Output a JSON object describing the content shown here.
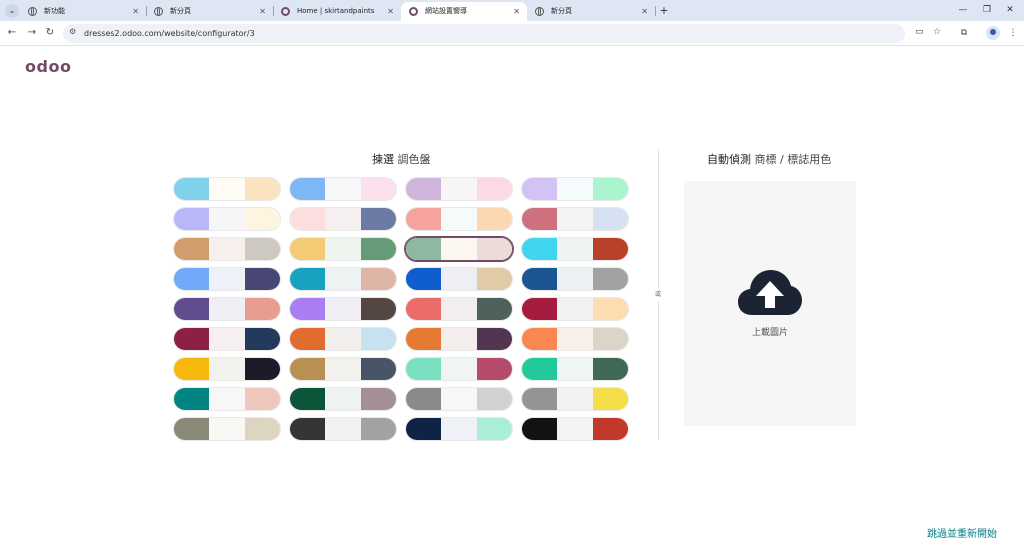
{
  "browser": {
    "tabs": [
      {
        "title": "新功能",
        "icon": "globe-icon"
      },
      {
        "title": "新分頁",
        "icon": "globe-icon"
      },
      {
        "title": "Home | skirtandpaints",
        "icon": "odoo-icon"
      },
      {
        "title": "網站設置嚮導",
        "icon": "odoo-icon",
        "active": true
      },
      {
        "title": "新分頁",
        "icon": "globe-icon"
      }
    ],
    "url": "dresses2.odoo.com/website/configurator/3"
  },
  "page": {
    "logo_text": "odoo",
    "palettes_title_strong": "揀選",
    "palettes_title_rest": " 調色盤",
    "detect_title_strong": "自動偵測",
    "detect_title_rest": " 商標 / 標誌用色",
    "or_label": "或",
    "upload_label": "上載圖片",
    "skip_label": "跳過並重新開始"
  },
  "palettes": [
    [
      "#7fd1ec",
      "#fffbf5",
      "#fce3c0"
    ],
    [
      "#7fb6f5",
      "#f6f7f9",
      "#fde0ee"
    ],
    [
      "#cfb5db",
      "#f7f6f5",
      "#fdd9e7"
    ],
    [
      "#d2c2f5",
      "#f6fbfd",
      "#aaf5cd"
    ],
    [
      "#b9b7f8",
      "#f6f6f9",
      "#fff4df"
    ],
    [
      "#fcdede",
      "#f6eff0",
      "#6b7ba5"
    ],
    [
      "#f6a3a0",
      "#f5fafb",
      "#fdd7b1"
    ],
    [
      "#cf707e",
      "#f4f4f4",
      "#d6e1f2"
    ],
    [
      "#d29d6d",
      "#f7f0ef",
      "#cdc8c1"
    ],
    [
      "#f5ca74",
      "#eef5ef",
      "#659b77"
    ],
    [
      "#8cb9a0",
      "#fbf6ef",
      "#ebdcd9"
    ],
    [
      "#3fd5f0",
      "#eef3f4",
      "#b9402b"
    ],
    [
      "#71aaf9",
      "#eef2f8",
      "#484675"
    ],
    [
      "#17a2c0",
      "#edf3f3",
      "#dfb5a8"
    ],
    [
      "#0f5dce",
      "#eeeff4",
      "#e0cba6"
    ],
    [
      "#1b5592",
      "#eef1f4",
      "#a2a2a0"
    ],
    [
      "#614d8e",
      "#f1eff6",
      "#e99d8e"
    ],
    [
      "#a97ef3",
      "#f1eef5",
      "#534643"
    ],
    [
      "#e96c68",
      "#f3eeee",
      "#4e615c"
    ],
    [
      "#a61c3f",
      "#f3f0f1",
      "#fddcb1"
    ],
    [
      "#8e2143",
      "#f6eff2",
      "#233a5d"
    ],
    [
      "#e06c2f",
      "#f3efec",
      "#c6e1ef"
    ],
    [
      "#e57a32",
      "#f4eeec",
      "#523651"
    ],
    [
      "#f9874f",
      "#f7f0ea",
      "#dcd4c9"
    ],
    [
      "#f6b80c",
      "#f4f2ee",
      "#1f1a29"
    ],
    [
      "#b89152",
      "#f3f1ee",
      "#475567"
    ],
    [
      "#7ae0c2",
      "#f0f5f3",
      "#b54a6a"
    ],
    [
      "#22c99b",
      "#eef5f2",
      "#3f6856"
    ],
    [
      "#028582",
      "#f7f7f7",
      "#f0c7bd"
    ],
    [
      "#0b5639",
      "#eef3f1",
      "#a48f99"
    ],
    [
      "#8a8a89",
      "#f7f7f7",
      "#d1d1d1"
    ],
    [
      "#949496",
      "#f2f2f2",
      "#f4df4b"
    ],
    [
      "#8a8876",
      "#f9f8f4",
      "#ddd5c2"
    ],
    [
      "#353535",
      "#f2f2f2",
      "#a2a2a2"
    ],
    [
      "#0f2344",
      "#eef1f6",
      "#abeed6"
    ],
    [
      "#121212",
      "#f3f3f3",
      "#c2392a"
    ]
  ],
  "selected_palette_index": 10,
  "colors": {
    "odoo_purple": "#714b67",
    "link_teal": "#017e84",
    "cloud_dark": "#1c2333"
  }
}
